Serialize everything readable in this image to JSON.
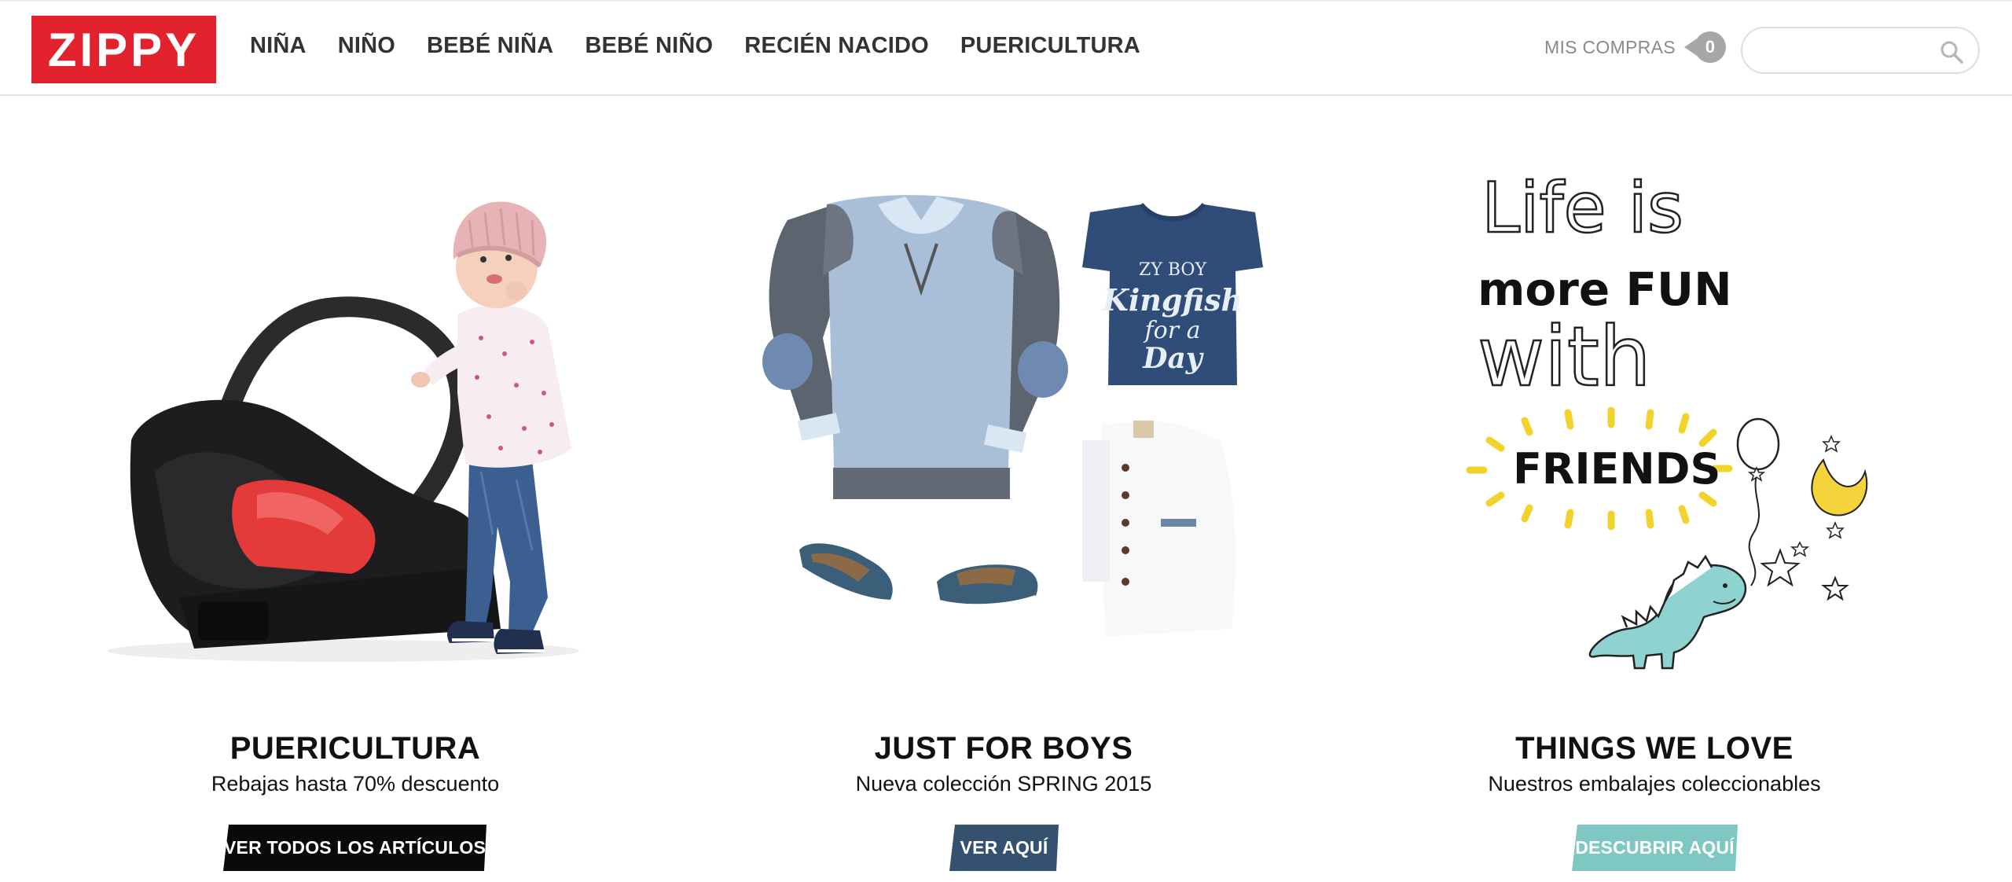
{
  "header": {
    "logo_text": "ZIPPY",
    "nav": [
      {
        "label": "NIÑA"
      },
      {
        "label": "NIÑO"
      },
      {
        "label": "BEBÉ NIÑA"
      },
      {
        "label": "BEBÉ NIÑO"
      },
      {
        "label": "RECIÉN NACIDO"
      },
      {
        "label": "PUERICULTURA"
      }
    ],
    "cart_label": "MIS COMPRAS",
    "cart_count": "0",
    "search_value": "",
    "search_icon": "search-icon"
  },
  "promos": [
    {
      "title": "PUERICULTURA",
      "subtitle": "Rebajas hasta 70% descuento",
      "button": "VER TODOS LOS ARTÍCULOS",
      "button_color": "#0a0a0a"
    },
    {
      "title": "JUST FOR BOYS",
      "subtitle": "Nueva colección SPRING 2015",
      "button": "VER AQUÍ",
      "button_color": "#36506f",
      "tshirt_text": [
        "ZY BOY",
        "Kingfish",
        "for a",
        "Day"
      ]
    },
    {
      "title": "THINGS WE LOVE",
      "subtitle": "Nuestros embalajes coleccionables",
      "button": "DESCUBRIR AQUÍ",
      "button_color": "#7ec7c3",
      "art_text": [
        "Life is",
        "more FUN",
        "with",
        "FRIENDS"
      ]
    }
  ],
  "colors": {
    "brand_red": "#e2232d",
    "accent_yellow": "#f2d32c",
    "dino_teal": "#8fd3d1"
  }
}
